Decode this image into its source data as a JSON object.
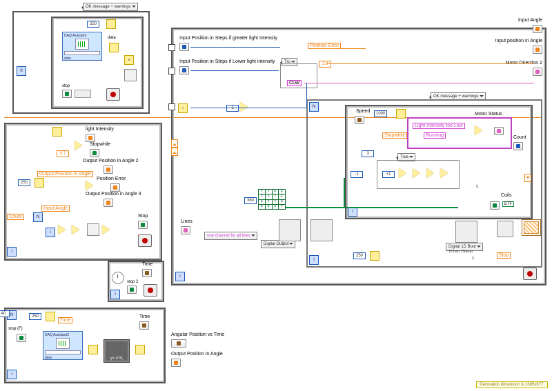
{
  "footer": "Decoration dimension is 1385x977.",
  "top_dropdown": "OK message + warnings",
  "right_dropdown": "OK message + warnings",
  "daq1": {
    "title": "DAQ Assistant",
    "out": "data",
    "side_label": "data"
  },
  "daq2": {
    "title": "DAQ Assistant2",
    "out": "data"
  },
  "consts": {
    "c250_1": "250",
    "c250_2": "250",
    "c250_3": "250",
    "c250_4": "250",
    "c0P7": "0.7",
    "c0": "0",
    "c40": "40",
    "c1": "1",
    "cneg1": "-1",
    "c3": "3",
    "c1P8": "1.8",
    "c360": "360",
    "c1000": "1000",
    "c5": "5.",
    "c2": "2."
  },
  "labels": {
    "light_intensity": "light Intensity",
    "stopwhile": "Stopwhile",
    "out_pos_angle2": "Output Position in Angle 2",
    "pos_error": "Position Error",
    "out_pos_angle3": "Output Position in Angle 3",
    "out_pos_angle_local": "Output Position in Angle",
    "input_angle_local": "Input Angle",
    "count_local": "Count",
    "stop": "Stop",
    "time": "Time",
    "stop2": "stop 2",
    "stopF": "stop (F)",
    "apvst": "Angular Position vs Time",
    "out_pos_angle": "Output Position in Angle",
    "time2": "Time",
    "in_pos_greater": "Input Position in Steps if greater light Intensity",
    "in_pos_lower": "Input Position in Steps if Lower light intensity",
    "pos_error_local": "Position Error",
    "stopwhile_local": "Stopwhile",
    "input_angle": "Input Angle",
    "input_pos_angle": "Input position in Angle",
    "motor_dir2": "Motor Direction 2",
    "speed": "Speed",
    "motor_status": "Motor Status",
    "light_low": "Light Intensity too Low",
    "running": "Running",
    "count": "Count",
    "coils": "Coils",
    "lines": "Lines",
    "one_channel": "one channel for all lines",
    "digital_output": "Digital Output",
    "dig_1d": "Digital 1D Bool",
    "dig_1d2": "1Chan 1Samp",
    "stop_local": "Stop",
    "formula": "y=  x*4;"
  },
  "case_true_outer": "Tru",
  "case_true_inner": "True",
  "clw": "CLW",
  "tf_grid": [
    "T",
    "T",
    "F",
    "F",
    "T",
    "F",
    "T",
    "F",
    "F",
    "T",
    "T",
    "F",
    "F",
    "F",
    "F",
    "T"
  ],
  "etf": "ETF"
}
